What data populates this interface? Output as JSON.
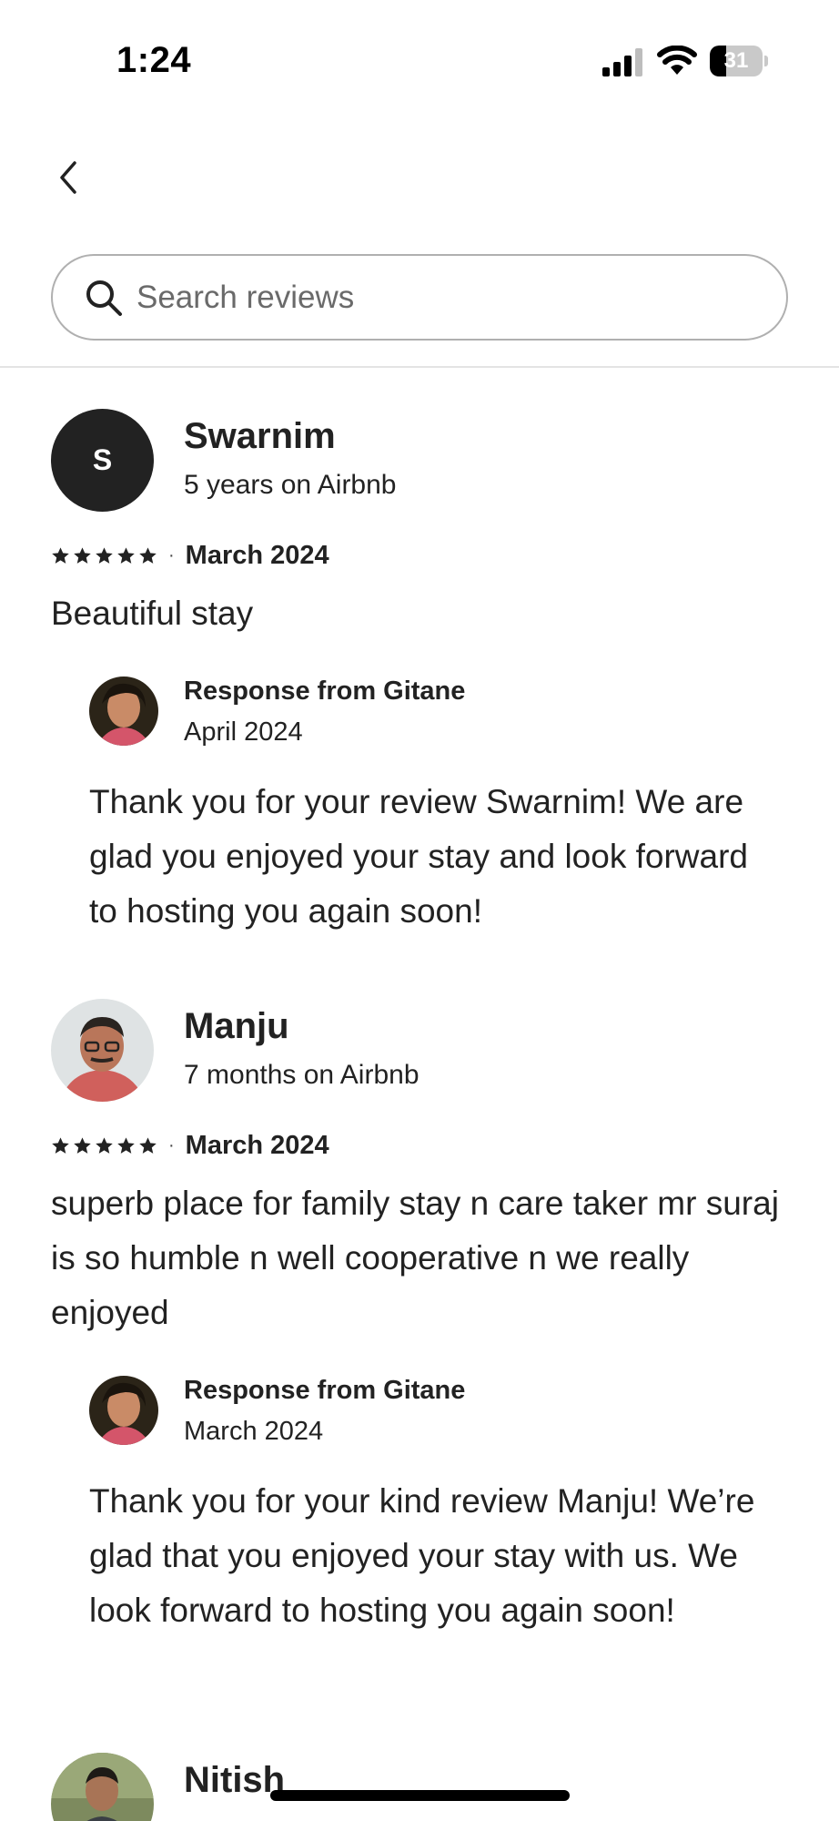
{
  "status_bar": {
    "time": "1:24",
    "battery_level": "31",
    "battery_fraction": 0.31
  },
  "nav": {
    "back_icon": "chevron-left-icon"
  },
  "search": {
    "placeholder": "Search reviews",
    "icon": "search-icon"
  },
  "reviews": [
    {
      "name": "Swarnim",
      "avatar_letter": "S",
      "tenure": "5 years on Airbnb",
      "stars": 5,
      "date": "March 2024",
      "text": "Beautiful stay",
      "response": {
        "title": "Response from Gitane",
        "date": "April 2024",
        "text": "Thank you for your review Swarnim! We are glad you enjoyed your stay and look forward to hosting you again soon!"
      }
    },
    {
      "name": "Manju",
      "tenure": "7 months on Airbnb",
      "stars": 5,
      "date": "March 2024",
      "text": "superb place for family stay n care taker mr suraj is so humble n well cooperative n we really enjoyed",
      "response": {
        "title": "Response from Gitane",
        "date": "March 2024",
        "text": "Thank you for your kind review Manju! We’re glad that you enjoyed your stay with us. We look forward to hosting you again soon!"
      }
    },
    {
      "name": "Nitish"
    }
  ],
  "colors": {
    "text": "#222222",
    "border": "#b0b0b0",
    "divider": "#e4e4e4",
    "avatar_bg": "#222222"
  }
}
